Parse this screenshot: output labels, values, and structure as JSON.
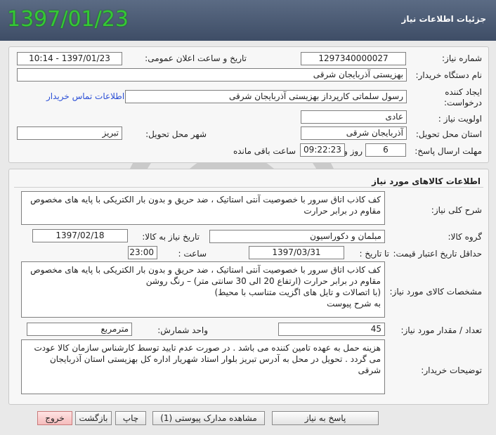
{
  "header": {
    "title": "جزئیات اطلاعات نیاز",
    "date_big": "1397/01/23"
  },
  "info": {
    "need_number_label": "شماره نیاز:",
    "need_number": "1297340000027",
    "announce_label": "تاریخ و ساعت اعلان عمومی:",
    "announce_value": "1397/01/23 - 10:14",
    "buyer_org_label": "نام دستگاه خریدار:",
    "buyer_org": "بهزیستی آذربایجان شرقی",
    "creator_label_1": "ایجاد کننده",
    "creator_label_2": "درخواست:",
    "creator": "رسول سلماتی کارپرداز بهزیستی آذربایجان شرقی",
    "contact_link": "اطلاعات تماس خریدار",
    "priority_label": "اولویت نیاز :",
    "priority": "عادی",
    "province_label": "استان محل تحویل:",
    "province": "آذربایجان شرقی",
    "city_label": "شهر محل تحویل:",
    "city": "تبریز",
    "deadline_label": "مهلت ارسال پاسخ:",
    "days": "6",
    "days_label": "روز و",
    "time": "09:22:23",
    "remaining_label": "ساعت باقی مانده"
  },
  "goods": {
    "section_title": "اطلاعات کالاهای مورد نیاز",
    "desc_label": "شرح کلی نیاز:",
    "desc": "کف کاذب اتاق سرور با خصوصیت آنتی استاتیک ، ضد حریق و بدون بار الکتریکی با پایه های مخصوص مقاوم در برابر حرارت",
    "group_label": "گروه کالا:",
    "group": "مبلمان و دکوراسیون",
    "need_date_label": "تاریخ نیاز به کالا:",
    "need_date": "1397/02/18",
    "validity_label": "حداقل تاریخ اعتبار قیمت:",
    "until_label": "تا تاریخ :",
    "validity_date": "1397/03/31",
    "hour_label": "ساعت :",
    "validity_time": "23:00",
    "specs_label": "مشخصات کالای مورد نیاز:",
    "specs_1": "کف کاذب اتاق سرور با خصوصیت آنتی استاتیک ، ضد حریق و بدون بار الکتریکی با پایه های مخصوص",
    "specs_2": "مقاوم در برابر حرارت (ارتفاع 20 الی 30 سانتی متر) – رنگ روشن",
    "specs_3": "(با اتصالات و تایل های اگزیت متناسب با محیط)",
    "specs_4": "به شرح پیوست",
    "qty_label": "تعداد / مقدار مورد نیاز:",
    "qty": "45",
    "unit_label": "واحد شمارش:",
    "unit": "مترمربع",
    "buyer_notes_label": "توضیحات خریدار:",
    "buyer_notes_1": "هزینه حمل به عهده تامین کننده می باشد . در صورت عدم تایید توسط کارشناس سازمان کالا عودت",
    "buyer_notes_2": "می گردد . تحویل در محل به آدرس تبریز بلوار استاد شهریار اداره کل بهزیستی استان آذربایجان شرقی"
  },
  "buttons": {
    "reply": "پاسخ به نیاز",
    "attachments": "مشاهده مدارک پیوستی (1)",
    "print": "چاپ",
    "back": "بازگشت",
    "exit": "خروج"
  }
}
